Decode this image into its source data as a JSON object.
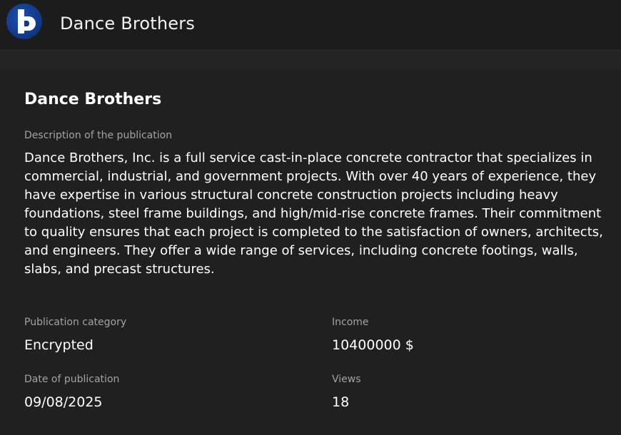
{
  "header": {
    "logo_icon": "brand-logo-icon",
    "logo_color": "#1e4fb0",
    "title": "Dance Brothers"
  },
  "publication": {
    "title": "Dance Brothers",
    "description_label": "Description of the publication",
    "description": "Dance Brothers, Inc. is a full service cast-in-place concrete contractor that specializes in commercial, industrial, and government projects. With over 40 years of experience, they have expertise in various structural concrete construction projects including heavy foundations, steel frame buildings, and high/mid-rise concrete frames. Their commitment to quality ensures that each project is completed to the satisfaction of owners, architects, and engineers. They offer a wide range of services, including concrete footings, walls, slabs, and precast structures.",
    "category_label": "Publication category",
    "category": "Encrypted",
    "income_label": "Income",
    "income": "10400000 $",
    "date_label": "Date of publication",
    "date": "09/08/2025",
    "views_label": "Views",
    "views": "18"
  }
}
